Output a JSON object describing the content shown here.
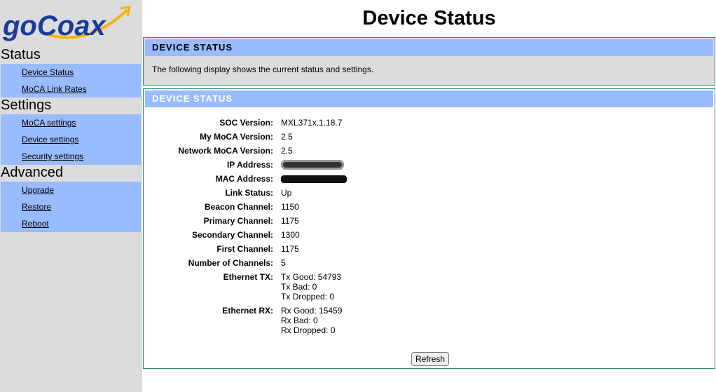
{
  "logo": {
    "text": "goCoax"
  },
  "sidebar": {
    "sections": [
      {
        "title": "Status",
        "items": [
          "Device Status",
          "MoCA Link Rates"
        ]
      },
      {
        "title": "Settings",
        "items": [
          "MoCA settings",
          "Device settings",
          "Security settings"
        ]
      },
      {
        "title": "Advanced",
        "items": [
          "Upgrade",
          "Restore",
          "Reboot"
        ]
      }
    ]
  },
  "page": {
    "title": "Device Status"
  },
  "panel1": {
    "heading": "DEVICE STATUS",
    "description": "The following display shows the current status and settings."
  },
  "panel2": {
    "heading": "DEVICE STATUS",
    "rows": [
      {
        "label": "SOC Version:",
        "value": "MXL371x.1.18.7"
      },
      {
        "label": "My MoCA Version:",
        "value": "2.5"
      },
      {
        "label": "Network MoCA Version:",
        "value": "2.5"
      },
      {
        "label": "IP Address:",
        "value": ""
      },
      {
        "label": "MAC Address:",
        "value": ""
      },
      {
        "label": "Link Status:",
        "value": "Up"
      },
      {
        "label": "Beacon Channel:",
        "value": "1150"
      },
      {
        "label": "Primary Channel:",
        "value": "1175"
      },
      {
        "label": "Secondary Channel:",
        "value": "1300"
      },
      {
        "label": "First Channel:",
        "value": "1175"
      },
      {
        "label": "Number of Channels:",
        "value": "5"
      }
    ],
    "ethernet_tx": {
      "label": "Ethernet TX:",
      "lines": [
        "Tx Good: 54793",
        "Tx Bad: 0",
        "Tx Dropped: 0"
      ]
    },
    "ethernet_rx": {
      "label": "Ethernet RX:",
      "lines": [
        "Rx Good: 15459",
        "Rx Bad: 0",
        "Rx Dropped: 0"
      ]
    },
    "refresh_label": "Refresh"
  },
  "colors": {
    "nav_bg": "#99bbff",
    "sidebar_bg": "#dcdcdc",
    "panel_border": "#2e8b6e",
    "logo_blue": "#1a3a9c",
    "logo_arrow": "#f2b600"
  }
}
